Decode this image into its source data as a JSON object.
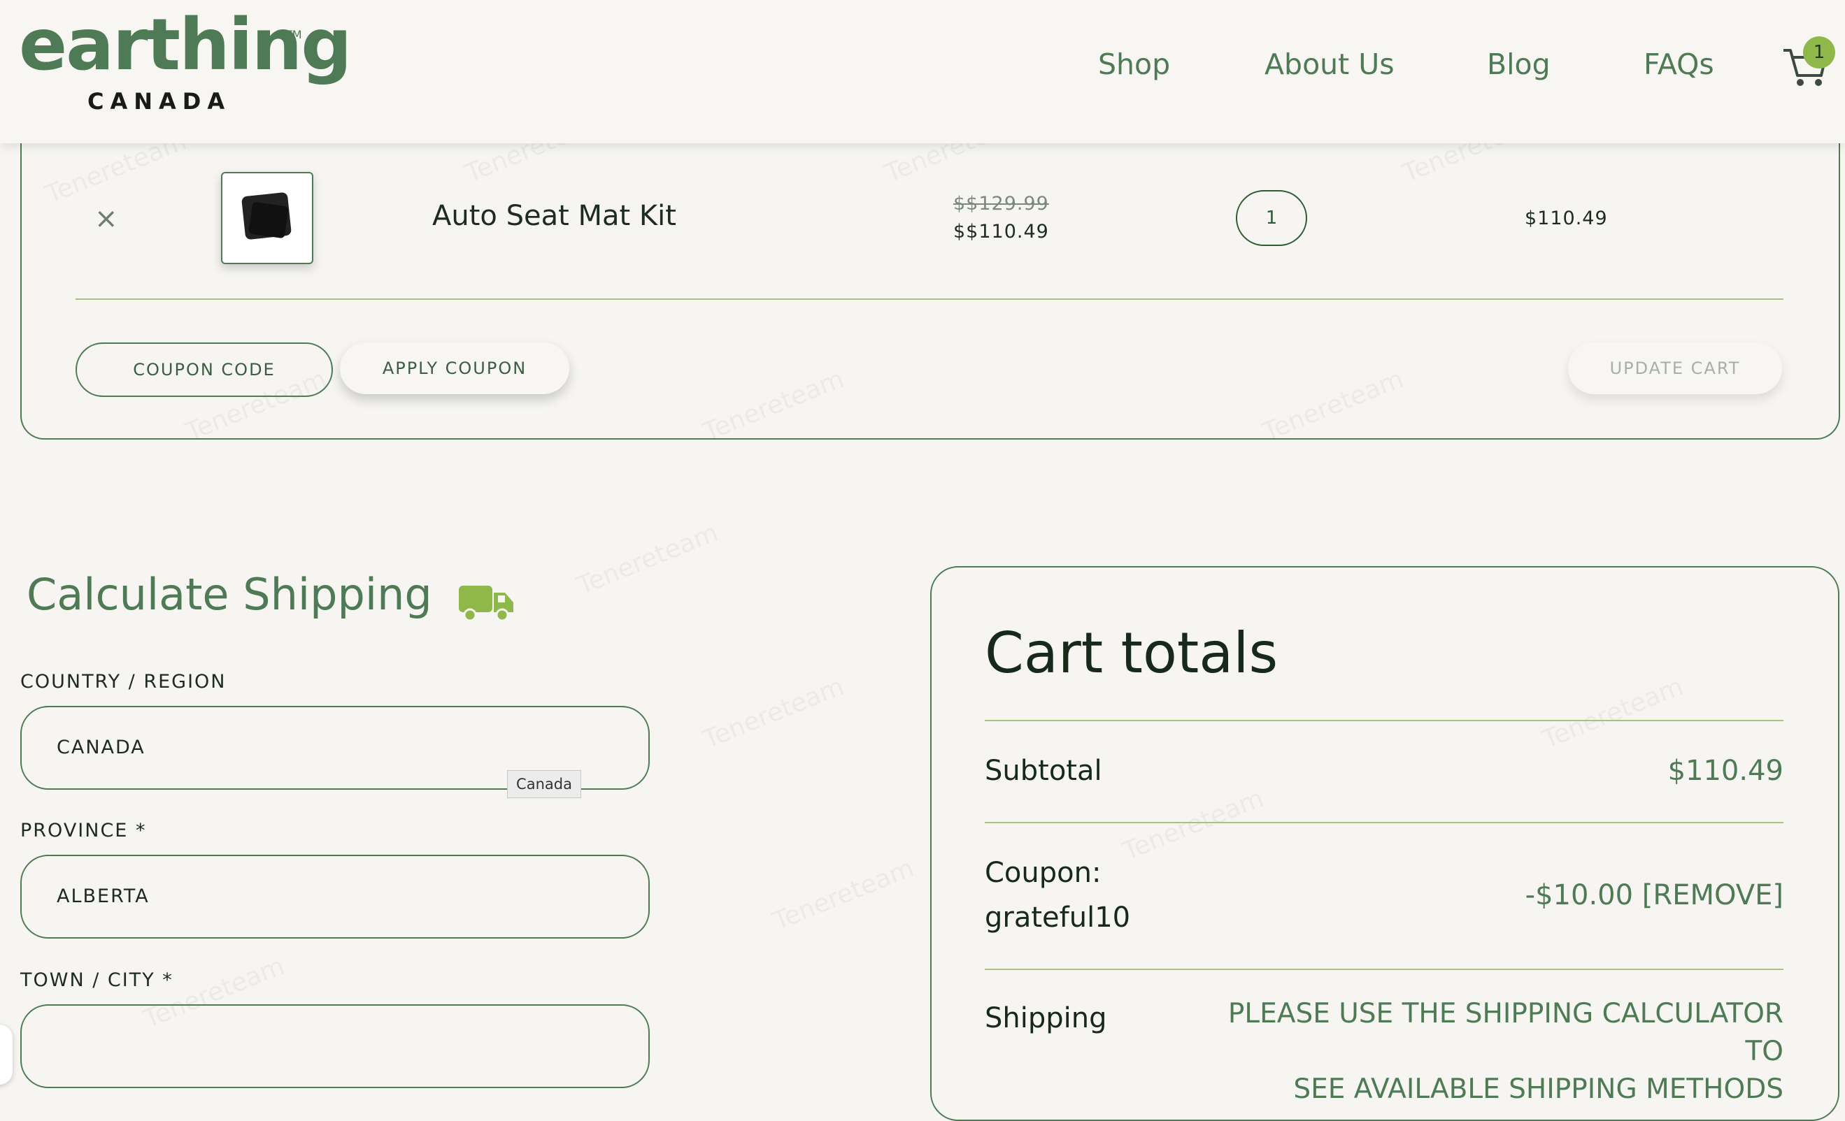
{
  "header": {
    "logo_word": "earthing",
    "logo_tm": "TM",
    "logo_sub": "CANADA",
    "nav": [
      "Shop",
      "About Us",
      "Blog",
      "FAQs"
    ],
    "cart_count": "1"
  },
  "cart": {
    "remove_symbol": "×",
    "product_name": "Auto Seat Mat Kit",
    "old_price": "$$129.99",
    "new_price": "$$110.49",
    "quantity": "1",
    "line_total": "$110.49",
    "coupon_placeholder": "COUPON CODE",
    "apply_label": "APPLY COUPON",
    "update_label": "UPDATE CART"
  },
  "shipping_calc": {
    "title": "Calculate Shipping",
    "country_label": "COUNTRY / REGION",
    "country_value": "CANADA",
    "country_tooltip": "Canada",
    "province_label": "PROVINCE *",
    "province_value": "ALBERTA",
    "city_label": "TOWN / CITY *",
    "city_value": ""
  },
  "totals": {
    "title": "Cart totals",
    "subtotal_label": "Subtotal",
    "subtotal_value": "$110.49",
    "coupon_label": "Coupon:",
    "coupon_code": "grateful10",
    "coupon_value": "-$10.00",
    "coupon_remove": "[REMOVE]",
    "shipping_label": "Shipping",
    "shipping_line1": "PLEASE USE THE SHIPPING CALCULATOR TO",
    "shipping_line2": "SEE AVAILABLE SHIPPING METHODS"
  },
  "watermark": "Tenereteam",
  "colors": {
    "brand_green": "#4e7a56",
    "accent_green": "#8fb84a",
    "divider": "#a9c17f"
  }
}
